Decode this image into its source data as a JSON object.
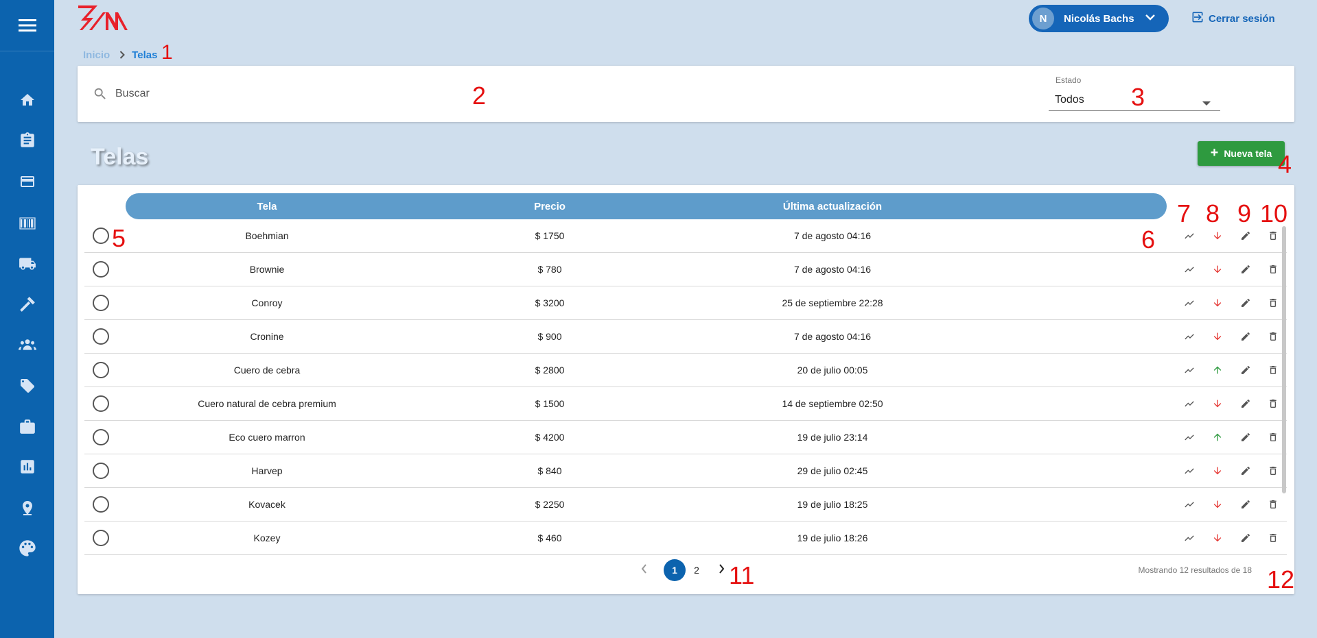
{
  "colors": {
    "sidebar": "#0c63ae",
    "background": "#cfdeed",
    "accent": "#1565b8",
    "header_row": "#5e9ccb",
    "new_button": "#2e9a3f",
    "trend_down": "#e53935",
    "trend_up": "#2e9a3f",
    "annotation": "#e51010"
  },
  "sidebar": {
    "menu_icon": "hamburger-menu-icon",
    "items": [
      {
        "icon": "home-icon"
      },
      {
        "icon": "clipboard-icon"
      },
      {
        "icon": "credit-card-icon"
      },
      {
        "icon": "barcode-icon"
      },
      {
        "icon": "truck-icon"
      },
      {
        "icon": "hammer-icon"
      },
      {
        "icon": "people-icon"
      },
      {
        "icon": "tag-icon"
      },
      {
        "icon": "briefcase-icon"
      },
      {
        "icon": "bar-chart-icon"
      },
      {
        "icon": "location-pin-icon"
      },
      {
        "icon": "palette-icon"
      }
    ]
  },
  "header": {
    "user": {
      "initial": "N",
      "name": "Nicolás Bachs"
    },
    "logout_label": "Cerrar sesión"
  },
  "breadcrumb": {
    "home": "Inicio",
    "current": "Telas"
  },
  "filters": {
    "search_placeholder": "Buscar",
    "estado_label": "Estado",
    "estado_value": "Todos"
  },
  "page": {
    "title": "Telas",
    "new_button_label": "Nueva tela"
  },
  "table": {
    "columns": [
      "Tela",
      "Precio",
      "Última actualización"
    ],
    "rows": [
      {
        "tela": "Boehmian",
        "precio": "$ 1750",
        "fecha": "7 de agosto 04:16",
        "trend": "down"
      },
      {
        "tela": "Brownie",
        "precio": "$ 780",
        "fecha": "7 de agosto 04:16",
        "trend": "down"
      },
      {
        "tela": "Conroy",
        "precio": "$ 3200",
        "fecha": "25 de septiembre 22:28",
        "trend": "down"
      },
      {
        "tela": "Cronine",
        "precio": "$ 900",
        "fecha": "7 de agosto 04:16",
        "trend": "down"
      },
      {
        "tela": "Cuero de cebra",
        "precio": "$ 2800",
        "fecha": "20 de julio 00:05",
        "trend": "up"
      },
      {
        "tela": "Cuero natural de cebra premium",
        "precio": "$ 1500",
        "fecha": "14 de septiembre 02:50",
        "trend": "down"
      },
      {
        "tela": "Eco cuero marron",
        "precio": "$ 4200",
        "fecha": "19 de julio 23:14",
        "trend": "up"
      },
      {
        "tela": "Harvep",
        "precio": "$ 840",
        "fecha": "29 de julio 02:45",
        "trend": "down"
      },
      {
        "tela": "Kovacek",
        "precio": "$ 2250",
        "fecha": "19 de julio 18:25",
        "trend": "down"
      },
      {
        "tela": "Kozey",
        "precio": "$ 460",
        "fecha": "19 de julio 18:26",
        "trend": "down"
      }
    ]
  },
  "pagination": {
    "pages": [
      "1",
      "2"
    ],
    "current": "1",
    "results_text": "Mostrando 12 resultados de 18"
  },
  "annotations": [
    "1",
    "2",
    "3",
    "4",
    "5",
    "6",
    "7",
    "8",
    "9",
    "10",
    "11",
    "12"
  ]
}
